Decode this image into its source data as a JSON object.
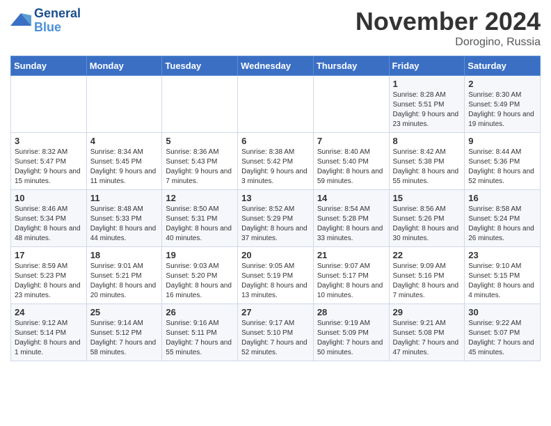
{
  "header": {
    "logo_line1": "General",
    "logo_line2": "Blue",
    "month": "November 2024",
    "location": "Dorogino, Russia"
  },
  "weekdays": [
    "Sunday",
    "Monday",
    "Tuesday",
    "Wednesday",
    "Thursday",
    "Friday",
    "Saturday"
  ],
  "weeks": [
    [
      {
        "day": "",
        "info": ""
      },
      {
        "day": "",
        "info": ""
      },
      {
        "day": "",
        "info": ""
      },
      {
        "day": "",
        "info": ""
      },
      {
        "day": "",
        "info": ""
      },
      {
        "day": "1",
        "info": "Sunrise: 8:28 AM\nSunset: 5:51 PM\nDaylight: 9 hours and 23 minutes."
      },
      {
        "day": "2",
        "info": "Sunrise: 8:30 AM\nSunset: 5:49 PM\nDaylight: 9 hours and 19 minutes."
      }
    ],
    [
      {
        "day": "3",
        "info": "Sunrise: 8:32 AM\nSunset: 5:47 PM\nDaylight: 9 hours and 15 minutes."
      },
      {
        "day": "4",
        "info": "Sunrise: 8:34 AM\nSunset: 5:45 PM\nDaylight: 9 hours and 11 minutes."
      },
      {
        "day": "5",
        "info": "Sunrise: 8:36 AM\nSunset: 5:43 PM\nDaylight: 9 hours and 7 minutes."
      },
      {
        "day": "6",
        "info": "Sunrise: 8:38 AM\nSunset: 5:42 PM\nDaylight: 9 hours and 3 minutes."
      },
      {
        "day": "7",
        "info": "Sunrise: 8:40 AM\nSunset: 5:40 PM\nDaylight: 8 hours and 59 minutes."
      },
      {
        "day": "8",
        "info": "Sunrise: 8:42 AM\nSunset: 5:38 PM\nDaylight: 8 hours and 55 minutes."
      },
      {
        "day": "9",
        "info": "Sunrise: 8:44 AM\nSunset: 5:36 PM\nDaylight: 8 hours and 52 minutes."
      }
    ],
    [
      {
        "day": "10",
        "info": "Sunrise: 8:46 AM\nSunset: 5:34 PM\nDaylight: 8 hours and 48 minutes."
      },
      {
        "day": "11",
        "info": "Sunrise: 8:48 AM\nSunset: 5:33 PM\nDaylight: 8 hours and 44 minutes."
      },
      {
        "day": "12",
        "info": "Sunrise: 8:50 AM\nSunset: 5:31 PM\nDaylight: 8 hours and 40 minutes."
      },
      {
        "day": "13",
        "info": "Sunrise: 8:52 AM\nSunset: 5:29 PM\nDaylight: 8 hours and 37 minutes."
      },
      {
        "day": "14",
        "info": "Sunrise: 8:54 AM\nSunset: 5:28 PM\nDaylight: 8 hours and 33 minutes."
      },
      {
        "day": "15",
        "info": "Sunrise: 8:56 AM\nSunset: 5:26 PM\nDaylight: 8 hours and 30 minutes."
      },
      {
        "day": "16",
        "info": "Sunrise: 8:58 AM\nSunset: 5:24 PM\nDaylight: 8 hours and 26 minutes."
      }
    ],
    [
      {
        "day": "17",
        "info": "Sunrise: 8:59 AM\nSunset: 5:23 PM\nDaylight: 8 hours and 23 minutes."
      },
      {
        "day": "18",
        "info": "Sunrise: 9:01 AM\nSunset: 5:21 PM\nDaylight: 8 hours and 20 minutes."
      },
      {
        "day": "19",
        "info": "Sunrise: 9:03 AM\nSunset: 5:20 PM\nDaylight: 8 hours and 16 minutes."
      },
      {
        "day": "20",
        "info": "Sunrise: 9:05 AM\nSunset: 5:19 PM\nDaylight: 8 hours and 13 minutes."
      },
      {
        "day": "21",
        "info": "Sunrise: 9:07 AM\nSunset: 5:17 PM\nDaylight: 8 hours and 10 minutes."
      },
      {
        "day": "22",
        "info": "Sunrise: 9:09 AM\nSunset: 5:16 PM\nDaylight: 8 hours and 7 minutes."
      },
      {
        "day": "23",
        "info": "Sunrise: 9:10 AM\nSunset: 5:15 PM\nDaylight: 8 hours and 4 minutes."
      }
    ],
    [
      {
        "day": "24",
        "info": "Sunrise: 9:12 AM\nSunset: 5:14 PM\nDaylight: 8 hours and 1 minute."
      },
      {
        "day": "25",
        "info": "Sunrise: 9:14 AM\nSunset: 5:12 PM\nDaylight: 7 hours and 58 minutes."
      },
      {
        "day": "26",
        "info": "Sunrise: 9:16 AM\nSunset: 5:11 PM\nDaylight: 7 hours and 55 minutes."
      },
      {
        "day": "27",
        "info": "Sunrise: 9:17 AM\nSunset: 5:10 PM\nDaylight: 7 hours and 52 minutes."
      },
      {
        "day": "28",
        "info": "Sunrise: 9:19 AM\nSunset: 5:09 PM\nDaylight: 7 hours and 50 minutes."
      },
      {
        "day": "29",
        "info": "Sunrise: 9:21 AM\nSunset: 5:08 PM\nDaylight: 7 hours and 47 minutes."
      },
      {
        "day": "30",
        "info": "Sunrise: 9:22 AM\nSunset: 5:07 PM\nDaylight: 7 hours and 45 minutes."
      }
    ]
  ]
}
